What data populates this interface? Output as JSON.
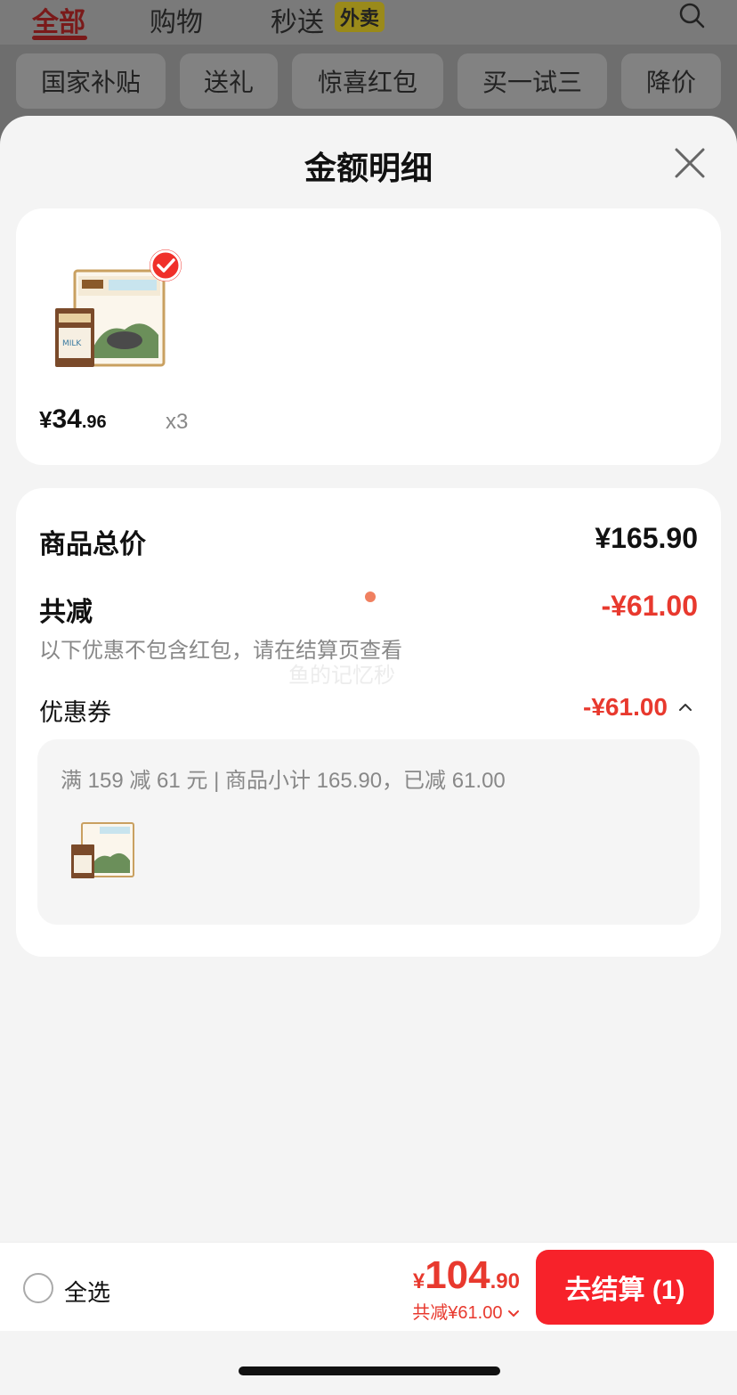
{
  "background": {
    "tabs": [
      {
        "label": "全部",
        "active": true
      },
      {
        "label": "购物",
        "active": false
      },
      {
        "label": "秒送",
        "active": false
      }
    ],
    "badge": "外卖",
    "chips": [
      "国家补贴",
      "送礼",
      "惊喜红包",
      "买一试三",
      "降价"
    ]
  },
  "sheet": {
    "title": "金额明细",
    "product": {
      "price_currency": "¥",
      "price_int": "34",
      "price_dec": ".96",
      "quantity": "x3"
    },
    "detail": {
      "subtotal_label": "商品总价",
      "subtotal_value": "¥165.90",
      "discount_label": "共减",
      "discount_value": "-¥61.00",
      "note": "以下优惠不包含红包，请在结算页查看",
      "watermark": "鱼的记忆秒",
      "coupon_label": "优惠券",
      "coupon_value": "-¥61.00",
      "coupon_desc": "满 159 减 61 元 | 商品小计 165.90，已减 61.00"
    }
  },
  "bottom_bar": {
    "select_all": "全选",
    "total_currency": "¥",
    "total_int": "104",
    "total_dec": ".90",
    "total_sub": "共减¥61.00",
    "checkout_label": "去结算 (1)"
  },
  "colors": {
    "accent_red": "#e8392e",
    "button_red": "#f7222a"
  }
}
